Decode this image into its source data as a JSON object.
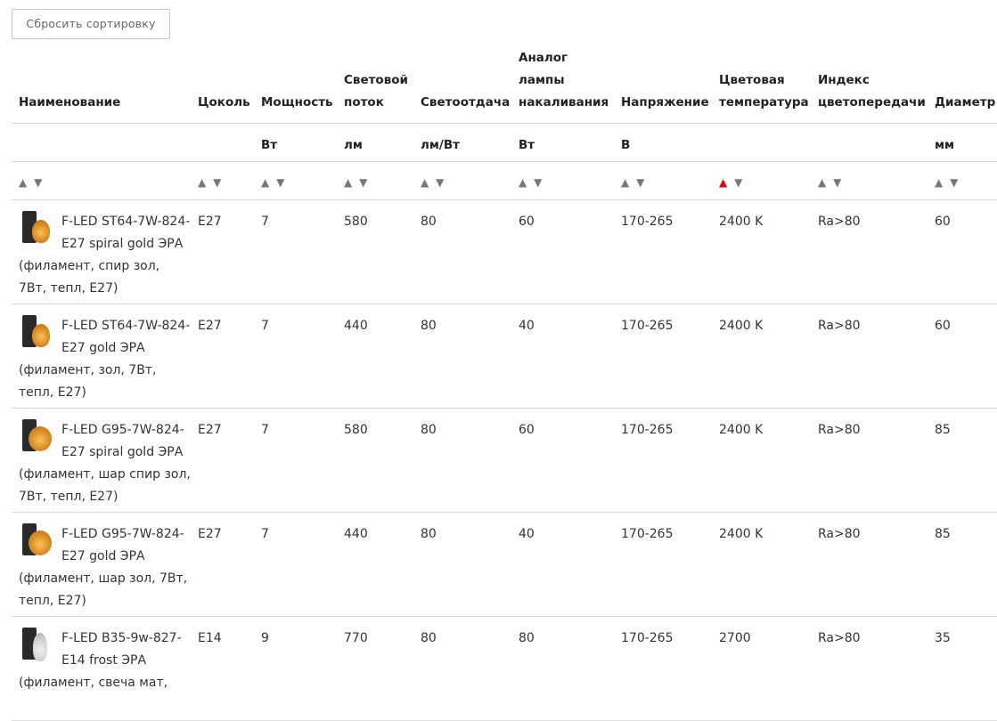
{
  "reset_button": "Сбросить сортировку",
  "columns": [
    {
      "header": "Наименование",
      "unit": ""
    },
    {
      "header": "Цоколь",
      "unit": ""
    },
    {
      "header": "Мощность",
      "unit": "Вт"
    },
    {
      "header": "Световой поток",
      "unit": "лм"
    },
    {
      "header": "Светоотдача",
      "unit": "лм/Вт"
    },
    {
      "header": "Аналог лампы накаливания",
      "unit": "Вт"
    },
    {
      "header": "Напряжение",
      "unit": "В"
    },
    {
      "header": "Цветовая температура",
      "unit": ""
    },
    {
      "header": "Индекс цветопередачи",
      "unit": ""
    },
    {
      "header": "Диаметр",
      "unit": "мм"
    }
  ],
  "sort": {
    "up": "▲",
    "down": "▼",
    "active_column": "Цветовая температура",
    "active_direction": "up"
  },
  "colors": {
    "active_sort": "#e00000",
    "inactive_sort": "#777777",
    "border": "#d9d9d9"
  },
  "rows": [
    {
      "icon": "lamp-st64-spiral-icon",
      "name": "F-LED ST64-7W-824-E27 spiral gold ЭРА (филамент, спир зол, 7Вт, тепл, E27)",
      "cap": "E27",
      "power": "7",
      "flux": "580",
      "efficacy": "80",
      "analog": "60",
      "voltage": "170-265",
      "temp": "2400 K",
      "cri": "Ra>80",
      "diameter": "60"
    },
    {
      "icon": "lamp-st64-gold-icon",
      "name": "F-LED ST64-7W-824-E27 gold ЭРА (филамент, зол, 7Вт, тепл, E27)",
      "cap": "E27",
      "power": "7",
      "flux": "440",
      "efficacy": "80",
      "analog": "40",
      "voltage": "170-265",
      "temp": "2400 K",
      "cri": "Ra>80",
      "diameter": "60"
    },
    {
      "icon": "lamp-g95-spiral-icon",
      "name": "F-LED G95-7W-824-E27 spiral gold ЭРА (филамент, шар спир зол, 7Вт, тепл, E27)",
      "cap": "E27",
      "power": "7",
      "flux": "580",
      "efficacy": "80",
      "analog": "60",
      "voltage": "170-265",
      "temp": "2400 K",
      "cri": "Ra>80",
      "diameter": "85"
    },
    {
      "icon": "lamp-g95-gold-icon",
      "name": "F-LED G95-7W-824-E27 gold ЭРА (филамент, шар зол, 7Вт, тепл, E27)",
      "cap": "E27",
      "power": "7",
      "flux": "440",
      "efficacy": "80",
      "analog": "40",
      "voltage": "170-265",
      "temp": "2400 K",
      "cri": "Ra>80",
      "diameter": "85"
    },
    {
      "icon": "lamp-b35-frost-icon",
      "name": "F-LED B35-9w-827-E14 frost ЭРА (филамент, свеча мат,",
      "cap": "E14",
      "power": "9",
      "flux": "770",
      "efficacy": "80",
      "analog": "80",
      "voltage": "170-265",
      "temp": "2700",
      "cri": "Ra>80",
      "diameter": "35"
    }
  ]
}
